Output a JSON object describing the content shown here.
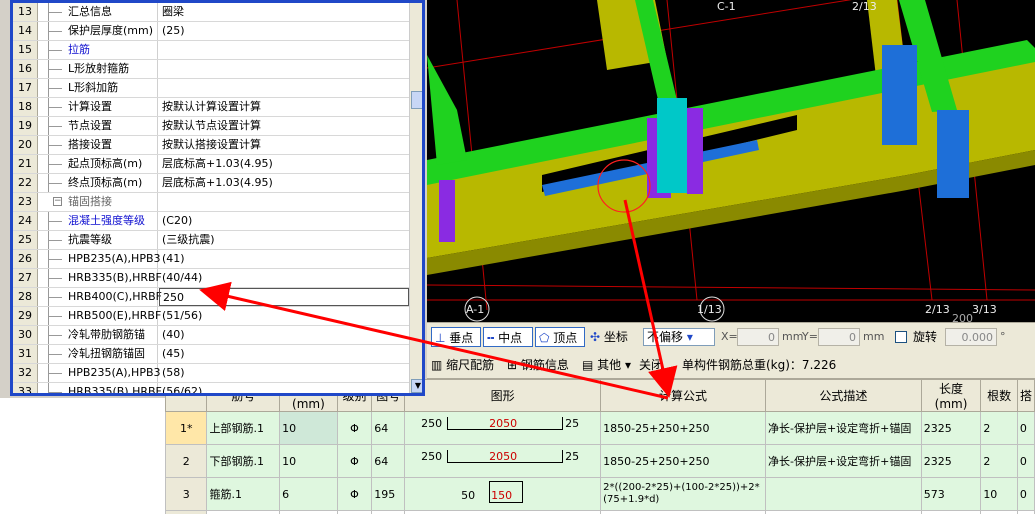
{
  "properties": {
    "rows": [
      {
        "num": "13",
        "name": "汇总信息",
        "value": "圈梁",
        "blue": false
      },
      {
        "num": "14",
        "name": "保护层厚度(mm)",
        "value": "(25)",
        "blue": false
      },
      {
        "num": "15",
        "name": "拉筋",
        "value": "",
        "blue": true
      },
      {
        "num": "16",
        "name": "L形放射箍筋",
        "value": "",
        "blue": false
      },
      {
        "num": "17",
        "name": "L形斜加筋",
        "value": "",
        "blue": false
      },
      {
        "num": "18",
        "name": "计算设置",
        "value": "按默认计算设置计算",
        "blue": false
      },
      {
        "num": "19",
        "name": "节点设置",
        "value": "按默认节点设置计算",
        "blue": false
      },
      {
        "num": "20",
        "name": "搭接设置",
        "value": "按默认搭接设置计算",
        "blue": false
      },
      {
        "num": "21",
        "name": "起点顶标高(m)",
        "value": "层底标高+1.03(4.95)",
        "blue": false
      },
      {
        "num": "22",
        "name": "终点顶标高(m)",
        "value": "层底标高+1.03(4.95)",
        "blue": false
      },
      {
        "num": "23",
        "name": "锚固搭接",
        "value": "",
        "blue": false,
        "group": true
      },
      {
        "num": "24",
        "name": "混凝土强度等级",
        "value": "(C20)",
        "blue": true
      },
      {
        "num": "25",
        "name": "抗震等级",
        "value": "(三级抗震)",
        "blue": false
      },
      {
        "num": "26",
        "name": "HPB235(A),HPB3",
        "value": "(41)",
        "blue": false
      },
      {
        "num": "27",
        "name": "HRB335(B),HRBF",
        "value": "(40/44)",
        "blue": false
      },
      {
        "num": "28",
        "name": "HRB400(C),HRBF",
        "value": "250",
        "blue": false
      },
      {
        "num": "29",
        "name": "HRB500(E),HRBF",
        "value": "(51/56)",
        "blue": false
      },
      {
        "num": "30",
        "name": "冷轧带肋钢筋锚",
        "value": "(40)",
        "blue": false
      },
      {
        "num": "31",
        "name": "冷轧扭钢筋锚固",
        "value": "(45)",
        "blue": false
      },
      {
        "num": "32",
        "name": "HPB235(A),HPB3",
        "value": "(58)",
        "blue": false
      },
      {
        "num": "33",
        "name": "HRB335(B),HRBF",
        "value": "(56/62)",
        "blue": false
      }
    ]
  },
  "viewport": {
    "axis_labels": {
      "c1": "C-1",
      "c2": "2/13",
      "a1": "A-1",
      "a13": "1/13",
      "a213": "2/13",
      "a313": "3/13",
      "dim": "200"
    }
  },
  "snapbar": {
    "perpendicular": "垂点",
    "midpoint": "中点",
    "vertex": "顶点",
    "coordinate": "坐标",
    "offset": "不偏移",
    "x_label": "X=",
    "x_value": "0",
    "x_unit": "mm",
    "y_label": "Y=",
    "y_value": "0",
    "y_unit": "mm",
    "rotate": "旋转",
    "rotate_value": "0.000",
    "degree": "°"
  },
  "rebarbar": {
    "scale": "缩尺配筋",
    "info": "钢筋信息",
    "other": "其他",
    "close": "关闭",
    "total_label": "单构件钢筋总重(kg)：7.226"
  },
  "table": {
    "headers": [
      "",
      "筋号",
      "直径(mm)",
      "级别",
      "图号",
      "图形",
      "计算公式",
      "公式描述",
      "长度(mm)",
      "根数",
      "搭"
    ],
    "rows": [
      {
        "rn": "1*",
        "name": "上部钢筋.1",
        "dia": "10",
        "grade": "Φ",
        "fig": "64",
        "left": "250",
        "mid": "2050",
        "right": "25",
        "formula": "1850-25+250+250",
        "desc": "净长-保护层+设定弯折+锚固",
        "len": "2325",
        "count": "2",
        "lap": "0"
      },
      {
        "rn": "2",
        "name": "下部钢筋.1",
        "dia": "10",
        "grade": "Φ",
        "fig": "64",
        "left": "250",
        "mid": "2050",
        "right": "25",
        "formula": "1850-25+250+250",
        "desc": "净长-保护层+设定弯折+锚固",
        "len": "2325",
        "count": "2",
        "lap": "0"
      },
      {
        "rn": "3",
        "name": "箍筋.1",
        "dia": "6",
        "grade": "Φ",
        "fig": "195",
        "left": "50",
        "mid": "150",
        "right": "",
        "formula": "2*((200-2*25)+(100-2*25))+2*(75+1.9*d)",
        "desc": "",
        "len": "573",
        "count": "10",
        "lap": "0"
      },
      {
        "rn": "4",
        "name": "",
        "dia": "",
        "grade": "",
        "fig": "",
        "left": "",
        "mid": "",
        "right": "",
        "formula": "",
        "desc": "",
        "len": "",
        "count": "",
        "lap": ""
      }
    ]
  },
  "colors": {
    "accent": "#2048c8",
    "annotation": "#ff0000",
    "beam_green": "#1fd21f",
    "column_blue": "#1e6fd8",
    "slab_yellow": "#b8b800"
  }
}
